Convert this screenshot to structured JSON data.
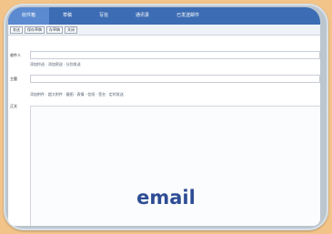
{
  "app": {
    "tabs": [
      {
        "label": "收件箱"
      },
      {
        "label": "草稿"
      },
      {
        "label": "写信"
      },
      {
        "label": "通讯录"
      },
      {
        "label": "已发送邮件"
      }
    ],
    "toolbar_buttons": [
      "发送",
      "保存草稿",
      "存草稿",
      "关闭"
    ],
    "fields": {
      "to_label": "收件人",
      "cc_label": "主题",
      "body_label": "正文"
    },
    "options_line_1": "添加抄送 · 添加密送 · 分别发送",
    "options_line_2": "添加附件 · 超大附件 · 截图 · 表情 · 信纸 · 签名 · 定时发送"
  },
  "caption": {
    "text": "email"
  },
  "colors": {
    "background": "#f2c489",
    "tabbar": "#3c6cb3",
    "caption": "#2e4d95"
  }
}
